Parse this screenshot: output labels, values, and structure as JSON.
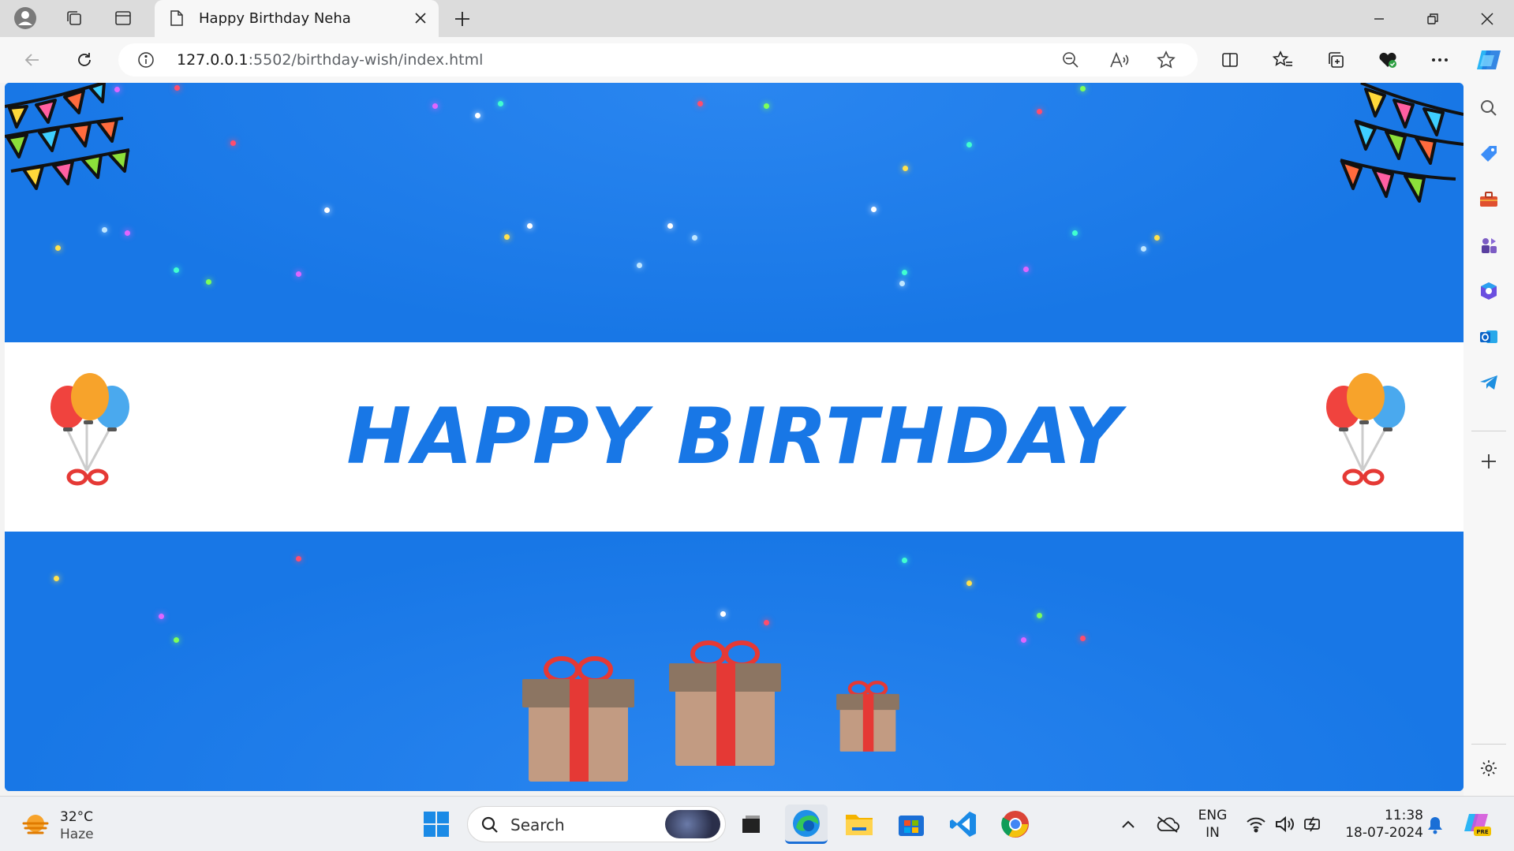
{
  "browser": {
    "tab_title": "Happy Birthday Neha",
    "url_host": "127.0.0.1",
    "url_path": ":5502/birthday-wish/index.html",
    "icons": [
      "profile-icon",
      "workspaces-icon",
      "vertical-tabs-icon",
      "tab-page-icon",
      "close-icon",
      "new-tab-icon",
      "minimize-icon",
      "restore-icon",
      "window-close-icon",
      "back-icon",
      "refresh-icon",
      "site-info-icon",
      "zoom-out-icon",
      "read-aloud-icon",
      "favorite-star-icon",
      "split-screen-icon",
      "favorites-icon",
      "collections-icon",
      "browser-essentials-icon",
      "more-icon",
      "copilot-icon"
    ]
  },
  "sidebar": {
    "items": [
      "search-icon",
      "shopping-tag-icon",
      "tools-icon",
      "games-icon",
      "microsoft-365-icon",
      "outlook-icon",
      "telegram-icon",
      "add-icon",
      "settings-icon"
    ]
  },
  "page": {
    "headline": "HAPPY BIRTHDAY",
    "colors": {
      "background": "#1c7ced",
      "band": "#ffffff",
      "headline": "#1877e6"
    }
  },
  "taskbar": {
    "weather_temp": "32°C",
    "weather_cond": "Haze",
    "search_label": "Search",
    "apps": [
      "windows-start-icon",
      "search-icon",
      "task-view-icon",
      "edge-icon",
      "file-explorer-icon",
      "microsoft-store-icon",
      "vscode-icon",
      "chrome-icon"
    ],
    "lang_line1": "ENG",
    "lang_line2": "IN",
    "time": "11:38",
    "date": "18-07-2024"
  }
}
